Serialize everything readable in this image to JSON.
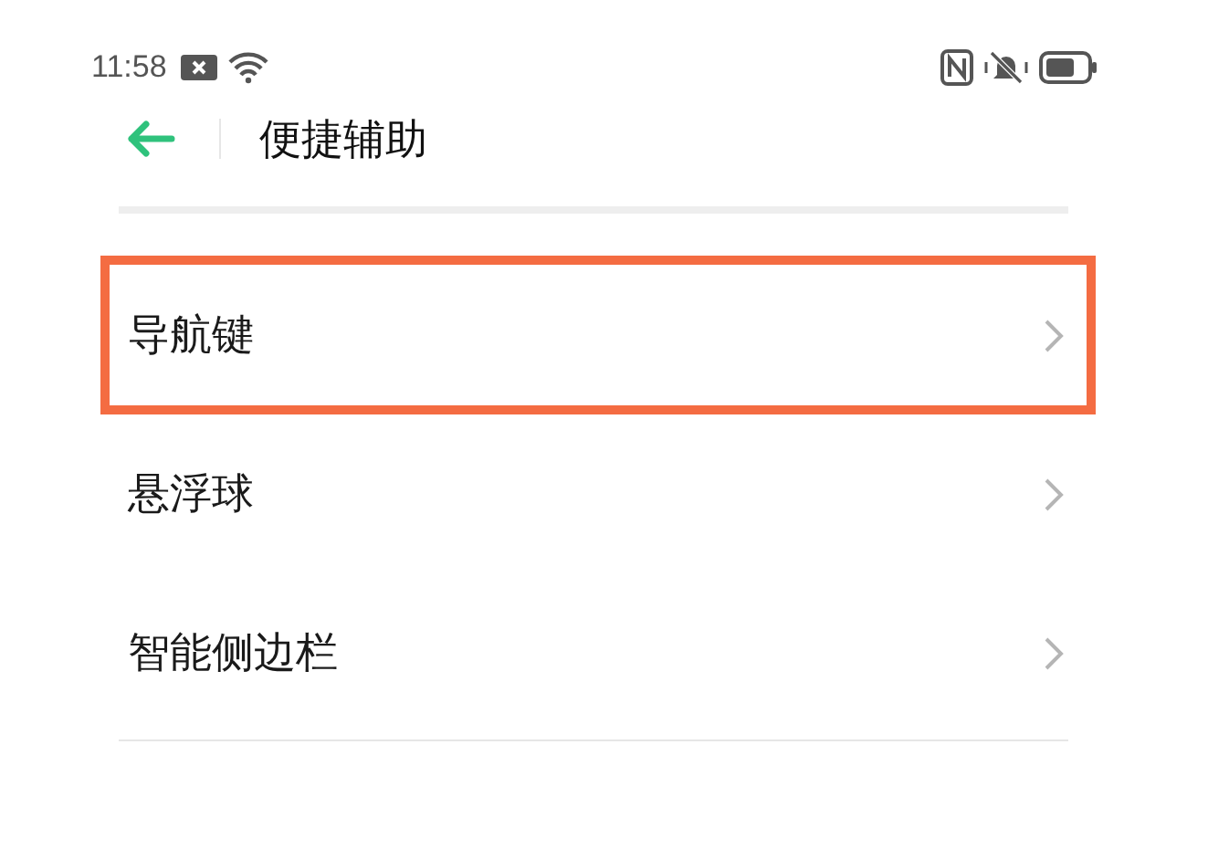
{
  "status_bar": {
    "time": "11:58"
  },
  "header": {
    "title": "便捷辅助"
  },
  "items": [
    {
      "label": "导航键",
      "highlighted": true
    },
    {
      "label": "悬浮球",
      "highlighted": false
    },
    {
      "label": "智能侧边栏",
      "highlighted": false
    }
  ]
}
